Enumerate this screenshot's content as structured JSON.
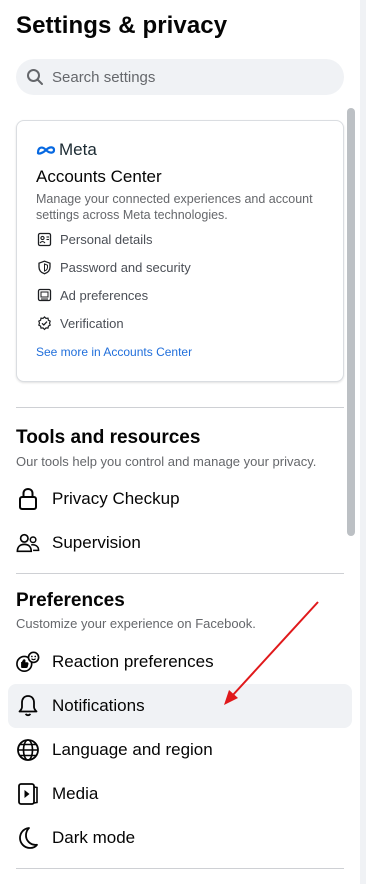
{
  "page": {
    "title": "Settings & privacy"
  },
  "search": {
    "placeholder": "Search settings"
  },
  "accounts_center": {
    "brand": "Meta",
    "title": "Accounts Center",
    "description": "Manage your connected experiences and account settings across Meta technologies.",
    "items": [
      {
        "label": "Personal details",
        "icon": "id-card-icon"
      },
      {
        "label": "Password and security",
        "icon": "shield-icon"
      },
      {
        "label": "Ad preferences",
        "icon": "monitor-icon"
      },
      {
        "label": "Verification",
        "icon": "verified-badge-icon"
      }
    ],
    "link": "See more in Accounts Center"
  },
  "tools": {
    "title": "Tools and resources",
    "description": "Our tools help you control and manage your privacy.",
    "items": [
      {
        "label": "Privacy Checkup",
        "icon": "lock-icon"
      },
      {
        "label": "Supervision",
        "icon": "people-icon"
      }
    ]
  },
  "preferences": {
    "title": "Preferences",
    "description": "Customize your experience on Facebook.",
    "items": [
      {
        "label": "Reaction preferences",
        "icon": "reactions-icon"
      },
      {
        "label": "Notifications",
        "icon": "bell-icon"
      },
      {
        "label": "Language and region",
        "icon": "globe-icon"
      },
      {
        "label": "Media",
        "icon": "media-icon"
      },
      {
        "label": "Dark mode",
        "icon": "moon-icon"
      }
    ]
  },
  "colors": {
    "accent": "#216fdb",
    "annotation": "#e0191b",
    "hover": "#f0f2f5"
  }
}
